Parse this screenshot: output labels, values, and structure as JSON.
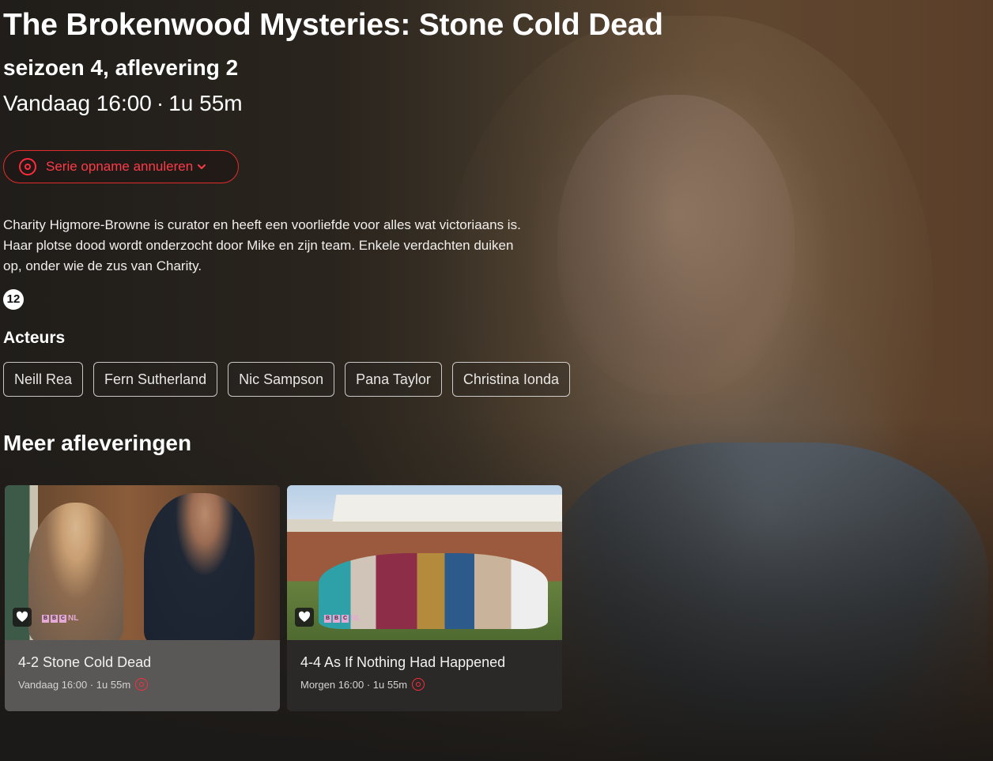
{
  "program": {
    "title": "The Brokenwood Mysteries: Stone Cold Dead",
    "subtitle": "seizoen 4, aflevering 2",
    "airtime": "Vandaag 16:00",
    "separator": "·",
    "duration": "1u 55m",
    "record_button_label": "Serie opname annuleren",
    "record_icon": "record-icon",
    "description": "Charity Higmore-Browne is curator en heeft een voorliefde voor alles wat victoriaans is. Haar plotse dood wordt onderzocht door Mike en zijn team. Enkele verdachten duiken op, onder wie de zus van Charity.",
    "age_rating": "12"
  },
  "cast": {
    "heading": "Acteurs",
    "members": [
      "Neill Rea",
      "Fern Sutherland",
      "Nic Sampson",
      "Pana Taylor",
      "Christina Ionda"
    ]
  },
  "more_episodes": {
    "heading": "Meer afleveringen",
    "items": [
      {
        "title": "4-2 Stone Cold Dead",
        "meta": "Vandaag 16:00 · 1u 55m",
        "channel": "BBC NL",
        "favorite_icon": "heart-icon",
        "recording": true
      },
      {
        "title": "4-4 As If Nothing Had Happened",
        "meta": "Morgen 16:00 · 1u 55m",
        "channel": "BBC NL",
        "favorite_icon": "heart-icon",
        "recording": true
      }
    ]
  },
  "colors": {
    "accent": "#ff2b3b"
  }
}
